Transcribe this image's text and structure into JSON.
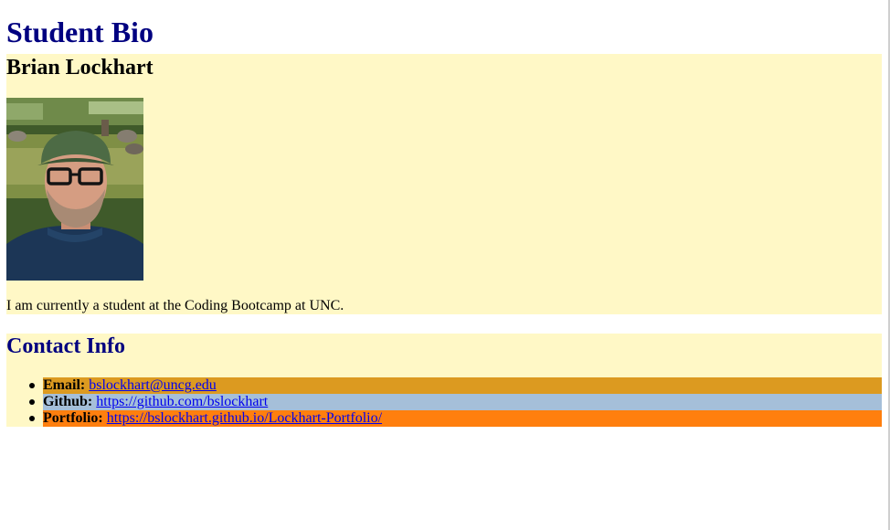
{
  "page": {
    "title": "Student Bio"
  },
  "bio": {
    "name": "Brian Lockhart",
    "photo_alt": "Photo of Brian Lockhart",
    "text": "I am currently a student at the Coding Bootcamp at UNC."
  },
  "contact": {
    "title": "Contact Info",
    "items": [
      {
        "label": "Email:",
        "value": "bslockhart@uncg.edu"
      },
      {
        "label": "Github:",
        "value": "https://github.com/bslockhart"
      },
      {
        "label": "Portfolio:",
        "value": "https://bslockhart.github.io/Lockhart-Portfolio/"
      }
    ]
  },
  "colors": {
    "heading": "#000080",
    "section_bg": "#fff8c6",
    "email_bg": "#dc9a20",
    "github_bg": "#a5bfd9",
    "portfolio_bg": "#ff7f0e",
    "link": "#0000ee"
  }
}
